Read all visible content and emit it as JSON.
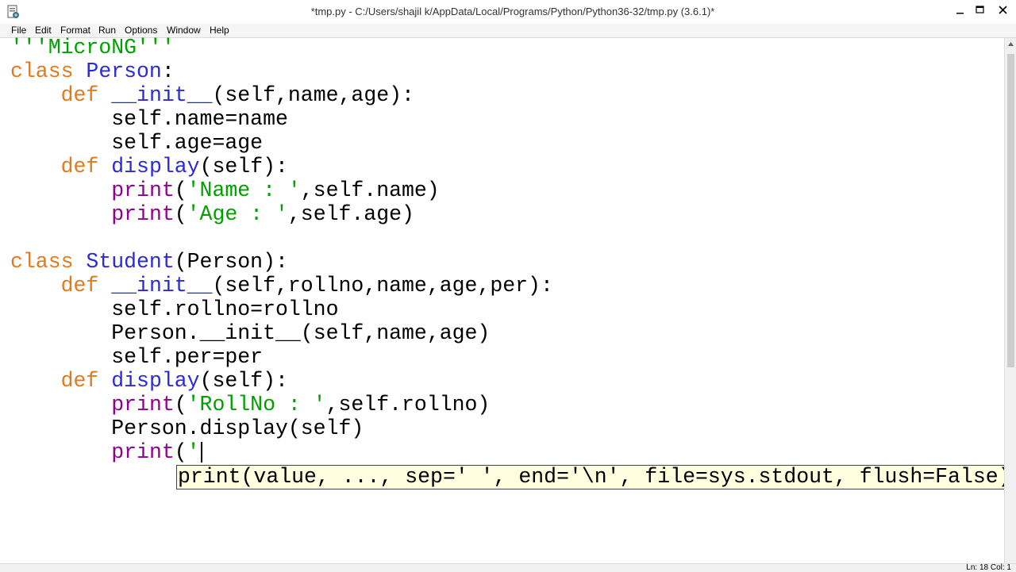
{
  "window": {
    "title": "*tmp.py - C:/Users/shajil k/AppData/Local/Programs/Python/Python36-32/tmp.py (3.6.1)*",
    "controls": {
      "minimize": "–",
      "maximize": "□",
      "close": "✕"
    }
  },
  "menu": [
    "File",
    "Edit",
    "Format",
    "Run",
    "Options",
    "Window",
    "Help"
  ],
  "code": {
    "docstring": "'''MicroNG'''",
    "kw_class": "class",
    "kw_def": "def",
    "person_name": "Person",
    "person_params": "(self,name,age):",
    "init_name": "__init__",
    "self_name_assign": "self.name=name",
    "self_age_assign": "self.age=age",
    "display_name": "display",
    "display_params": "(self):",
    "print_fn": "print",
    "str_name": "'Name : '",
    "self_name_tail": ",self.name)",
    "str_age": "'Age : '",
    "self_age_tail": ",self.age)",
    "student_name": "Student",
    "student_base": "(Person):",
    "student_init_params": "(self,rollno,name,age,per):",
    "self_rollno_assign": "self.rollno=rollno",
    "person_init_call_a": "Person.",
    "person_init_call_b": "(self,name,age)",
    "self_per_assign": "self.per=per",
    "str_rollno": "'RollNo : '",
    "self_rollno_tail": ",self.rollno)",
    "person_display_call": "Person.display(self)",
    "open_paren": "(",
    "colon": ":",
    "partial_str": "'"
  },
  "calltip": "print(value, ..., sep=' ', end='\\n', file=sys.stdout, flush=False)",
  "status": {
    "line_col": "Ln: 18   Col: 1"
  },
  "colors": {
    "keyword": "#e07a1f",
    "definition": "#2b2bd6",
    "builtin": "#900090",
    "string": "#00a000",
    "calltip_bg": "#ffffe0"
  }
}
